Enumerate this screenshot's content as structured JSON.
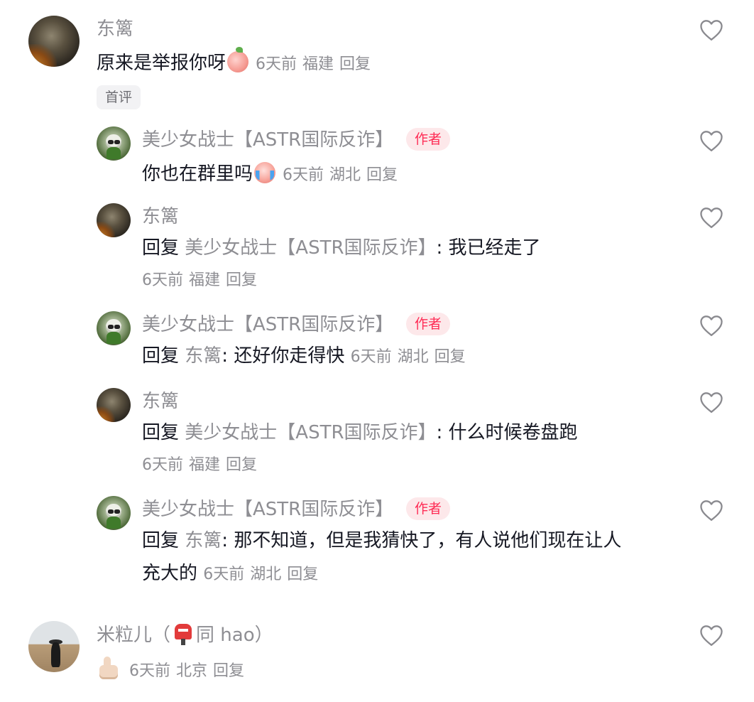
{
  "comments": [
    {
      "username": "东篱",
      "text": "原来是举报你呀",
      "time": "6天前",
      "location": "福建",
      "reply": "回复",
      "first_tag": "首评"
    },
    {
      "username": "美少女战士【ASTR国际反诈】",
      "author_badge": "作者",
      "text": "你也在群里吗",
      "time": "6天前",
      "location": "湖北",
      "reply": "回复"
    },
    {
      "username": "东篱",
      "reply_prefix": "回复",
      "reply_to": "美少女战士【ASTR国际反诈】",
      "text": ": 我已经走了",
      "time": "6天前",
      "location": "福建",
      "reply": "回复"
    },
    {
      "username": "美少女战士【ASTR国际反诈】",
      "author_badge": "作者",
      "reply_prefix": "回复",
      "reply_to": "东篱",
      "text": ": 还好你走得快",
      "time": "6天前",
      "location": "湖北",
      "reply": "回复"
    },
    {
      "username": "东篱",
      "reply_prefix": "回复",
      "reply_to": "美少女战士【ASTR国际反诈】",
      "text": ": 什么时候卷盘跑",
      "time": "6天前",
      "location": "福建",
      "reply": "回复"
    },
    {
      "username": "美少女战士【ASTR国际反诈】",
      "author_badge": "作者",
      "reply_prefix": "回复",
      "reply_to": "东篱",
      "text": ": 那不知道，但是我猜快了，有人说他们现在让人",
      "text_line2": "充大的",
      "time": "6天前",
      "location": "湖北",
      "reply": "回复"
    },
    {
      "username_prefix": "米粒儿（",
      "username_suffix": "同 hao）",
      "time": "6天前",
      "location": "北京",
      "reply": "回复"
    }
  ]
}
